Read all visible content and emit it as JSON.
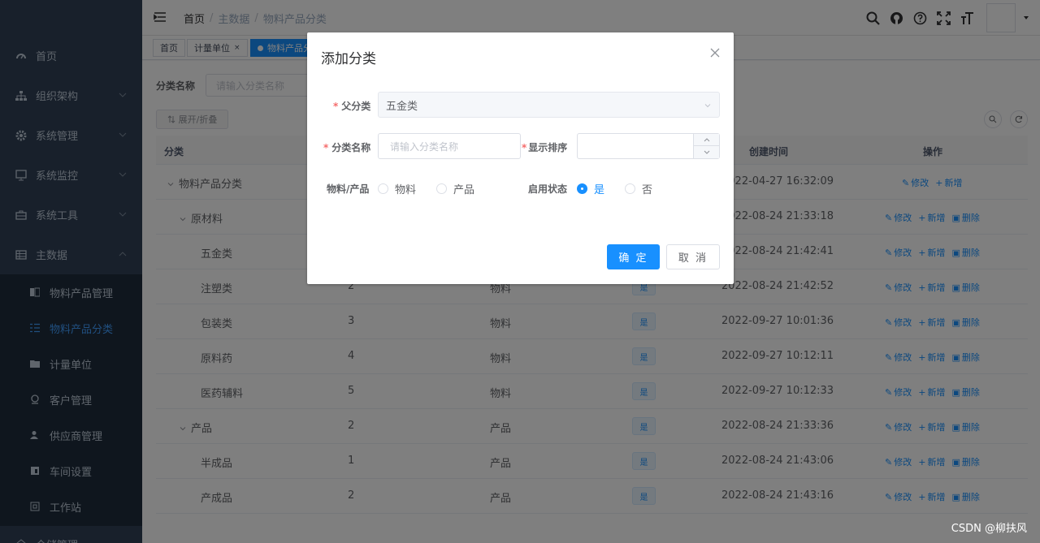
{
  "sidebar": {
    "items": [
      {
        "label": "首页",
        "icon": "dashboard-icon",
        "has_arrow": false
      },
      {
        "label": "组织架构",
        "icon": "tree-icon",
        "has_arrow": true
      },
      {
        "label": "系统管理",
        "icon": "gear-icon",
        "has_arrow": true
      },
      {
        "label": "系统监控",
        "icon": "monitor-icon",
        "has_arrow": true
      },
      {
        "label": "系统工具",
        "icon": "toolbox-icon",
        "has_arrow": true
      },
      {
        "label": "主数据",
        "icon": "table-icon",
        "has_arrow": true
      }
    ],
    "subitems": [
      {
        "label": "物料产品管理",
        "icon": "product-icon",
        "active": false
      },
      {
        "label": "物料产品分类",
        "icon": "category-icon",
        "active": true
      },
      {
        "label": "计量单位",
        "icon": "unit-icon",
        "active": false
      },
      {
        "label": "客户管理",
        "icon": "customer-icon",
        "active": false
      },
      {
        "label": "供应商管理",
        "icon": "supplier-icon",
        "active": false
      },
      {
        "label": "车间设置",
        "icon": "workshop-icon",
        "active": false
      },
      {
        "label": "工作站",
        "icon": "workstation-icon",
        "active": false
      }
    ],
    "partial_item": "仓储管理"
  },
  "header": {
    "breadcrumb": [
      "首页",
      "主数据",
      "物料产品分类"
    ],
    "separator": "/"
  },
  "tags": [
    {
      "label": "首页",
      "active": false,
      "closable": false
    },
    {
      "label": "计量单位",
      "active": false,
      "closable": true
    },
    {
      "label": "物料产品分类",
      "active": true,
      "closable": true
    }
  ],
  "search": {
    "label": "分类名称",
    "placeholder": "请输入分类名称",
    "expand_label": "展开/折叠"
  },
  "table": {
    "columns": [
      "分类",
      "创建时间",
      "操作"
    ],
    "rows": [
      {
        "name": "物料产品分类",
        "level": 0,
        "expanded": true,
        "order": "",
        "type": "",
        "enabled": "",
        "created": "2022-04-27 16:32:09",
        "ops": [
          "修改",
          "新增"
        ]
      },
      {
        "name": "原材料",
        "level": 1,
        "expanded": true,
        "order": "",
        "type": "",
        "enabled": "",
        "created": "2022-08-24 21:33:18",
        "ops": [
          "修改",
          "新增",
          "删除"
        ]
      },
      {
        "name": "五金类",
        "level": 2,
        "expanded": false,
        "order": "",
        "type": "",
        "enabled": "",
        "created": "2022-08-24 21:42:41",
        "ops": [
          "修改",
          "新增",
          "删除"
        ]
      },
      {
        "name": "注塑类",
        "level": 2,
        "expanded": false,
        "order": "2",
        "type": "物料",
        "enabled": "是",
        "created": "2022-08-24 21:42:52",
        "ops": [
          "修改",
          "新增",
          "删除"
        ]
      },
      {
        "name": "包装类",
        "level": 2,
        "expanded": false,
        "order": "3",
        "type": "物料",
        "enabled": "是",
        "created": "2022-09-27 10:01:36",
        "ops": [
          "修改",
          "新增",
          "删除"
        ]
      },
      {
        "name": "原料药",
        "level": 2,
        "expanded": false,
        "order": "4",
        "type": "物料",
        "enabled": "是",
        "created": "2022-09-27 10:12:11",
        "ops": [
          "修改",
          "新增",
          "删除"
        ]
      },
      {
        "name": "医药辅料",
        "level": 2,
        "expanded": false,
        "order": "5",
        "type": "物料",
        "enabled": "是",
        "created": "2022-09-27 10:12:33",
        "ops": [
          "修改",
          "新增",
          "删除"
        ]
      },
      {
        "name": "产品",
        "level": 1,
        "expanded": true,
        "order": "2",
        "type": "产品",
        "enabled": "是",
        "created": "2022-08-24 21:33:36",
        "ops": [
          "修改",
          "新增",
          "删除"
        ]
      },
      {
        "name": "半成品",
        "level": 2,
        "expanded": false,
        "order": "1",
        "type": "产品",
        "enabled": "是",
        "created": "2022-08-24 21:43:06",
        "ops": [
          "修改",
          "新增",
          "删除"
        ]
      },
      {
        "name": "产成品",
        "level": 2,
        "expanded": false,
        "order": "2",
        "type": "产品",
        "enabled": "是",
        "created": "2022-08-24 21:43:16",
        "ops": [
          "修改",
          "新增",
          "删除"
        ]
      }
    ]
  },
  "dialog": {
    "title": "添加分类",
    "required_mark": "*",
    "parent_label": "父分类",
    "parent_value": "五金类",
    "name_label": "分类名称",
    "name_placeholder": "请输入分类名称",
    "order_label": "显示排序",
    "order_value": "",
    "type_label": "物料/产品",
    "type_options": [
      "物料",
      "产品"
    ],
    "type_selected": "",
    "status_label": "启用状态",
    "status_options": [
      "是",
      "否"
    ],
    "status_selected": "是",
    "confirm_label": "确 定",
    "cancel_label": "取 消"
  },
  "watermark": "CSDN @柳扶风",
  "colors": {
    "sidebar_bg": "#304156",
    "submenu_bg": "#1f2d3d",
    "primary": "#1890ff",
    "required": "#f56c6c"
  }
}
